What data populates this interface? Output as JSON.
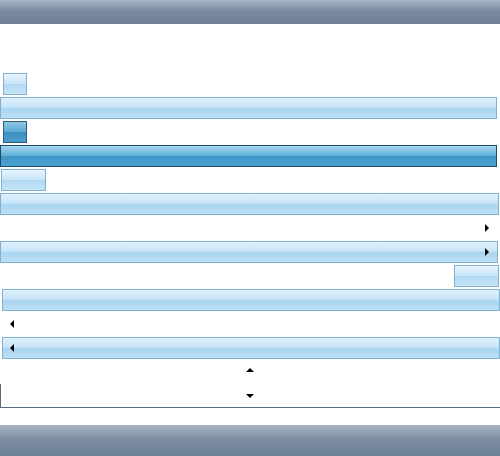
{
  "window": {
    "title": "",
    "status": ""
  },
  "icons": {
    "scroll_right": "arrow-right-icon",
    "scroll_left": "arrow-left-icon",
    "spin_up": "arrow-up-icon",
    "spin_down": "arrow-down-icon"
  },
  "colors": {
    "chrome": "#7c8da2",
    "light_accent": "#c4e3f7",
    "dark_accent": "#4aa2cf",
    "border_light": "#7fb0cf",
    "border_dark": "#1f4a63"
  },
  "widgets": {
    "button_light_label": "",
    "button_dark_label": "",
    "button_wide_label": "",
    "button_right_label": "",
    "spin_value": ""
  }
}
